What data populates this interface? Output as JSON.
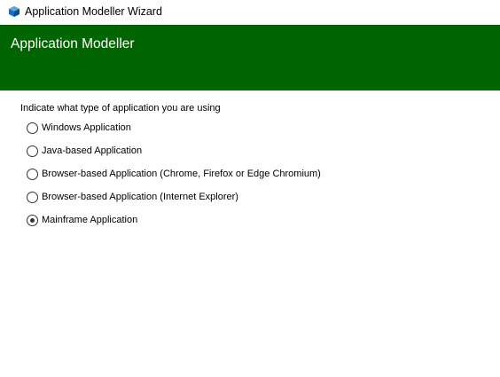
{
  "window": {
    "title": "Application Modeller Wizard",
    "icon": "blue-prism-app-icon"
  },
  "banner": {
    "title": "Application Modeller",
    "background_color": "#006400"
  },
  "form": {
    "prompt": "Indicate what type of application you are using",
    "options": [
      {
        "label": "Windows Application",
        "selected": false
      },
      {
        "label": "Java-based Application",
        "selected": false
      },
      {
        "label": "Browser-based Application (Chrome, Firefox or Edge Chromium)",
        "selected": false
      },
      {
        "label": "Browser-based Application (Internet Explorer)",
        "selected": false
      },
      {
        "label": "Mainframe Application",
        "selected": true
      }
    ]
  }
}
